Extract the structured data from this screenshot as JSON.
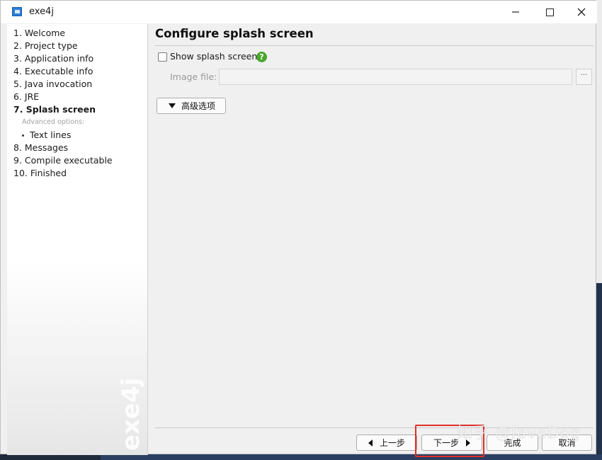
{
  "window": {
    "title": "exe4j"
  },
  "sidebar": {
    "steps": [
      {
        "label": "1. Welcome"
      },
      {
        "label": "2. Project type"
      },
      {
        "label": "3. Application info"
      },
      {
        "label": "4. Executable info"
      },
      {
        "label": "5. Java invocation"
      },
      {
        "label": "6. JRE"
      },
      {
        "label": "7. Splash screen"
      },
      {
        "label": "8. Messages"
      },
      {
        "label": "9. Compile executable"
      },
      {
        "label": "10. Finished"
      }
    ],
    "advanced_header": "Advanced options:",
    "advanced_items": [
      {
        "label": "Text lines"
      }
    ],
    "active_step": "7. Splash screen",
    "logo_text": "exe4j"
  },
  "main": {
    "title": "Configure splash screen",
    "show_splash": {
      "label": "Show splash screen",
      "checked": false
    },
    "help_icon": "?",
    "image_file": {
      "label": "Image file:",
      "value": "",
      "browse_label": "···"
    },
    "advanced_button": "高级选项"
  },
  "footer": {
    "back_label": "上一步",
    "next_label": "下一步",
    "finish_label": "完成",
    "cancel_label": "取消"
  },
  "overlay": {
    "watermark": "知乎 @JavaDog"
  },
  "colors": {
    "accent": "#2a7fd4",
    "help": "#4aa52e",
    "highlight": "#e0302a"
  }
}
